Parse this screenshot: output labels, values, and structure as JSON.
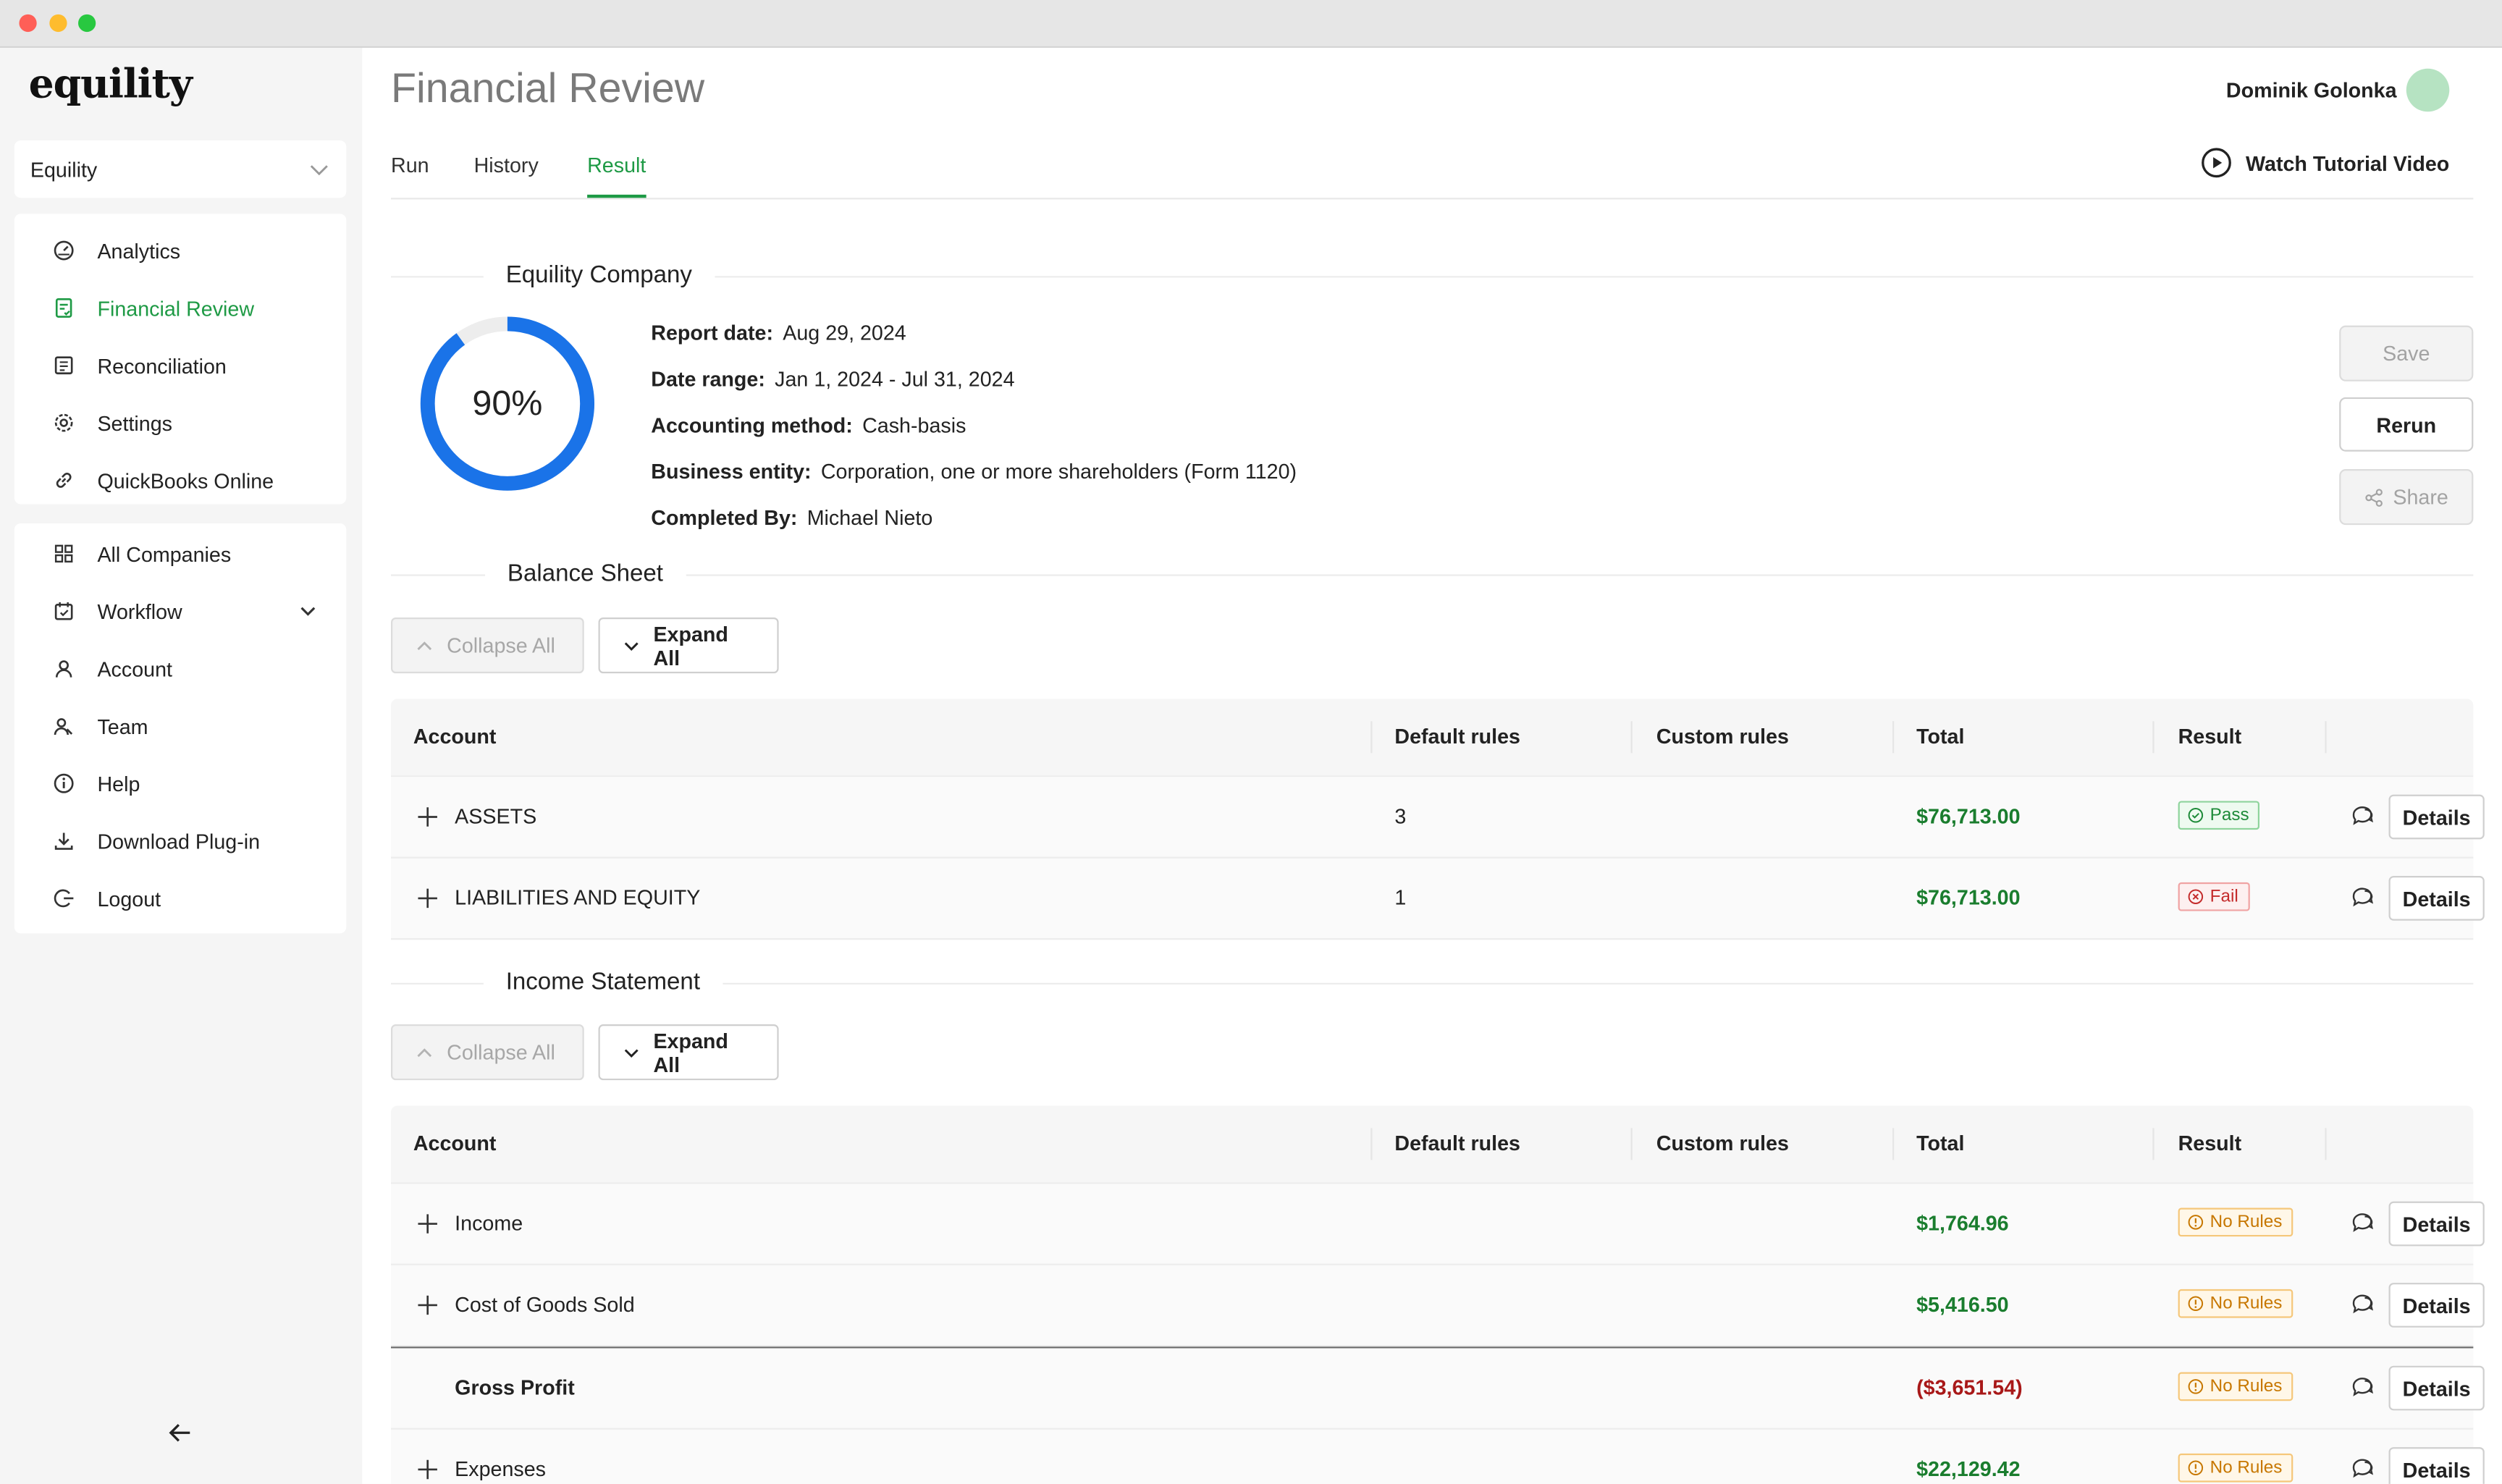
{
  "sidebar": {
    "logo": "equility",
    "company_select": "Equility",
    "group1": [
      {
        "label": "Analytics",
        "icon": "gauge-icon"
      },
      {
        "label": "Financial Review",
        "icon": "document-check-icon",
        "active": true
      },
      {
        "label": "Reconciliation",
        "icon": "ledger-icon"
      },
      {
        "label": "Settings",
        "icon": "gear-icon"
      },
      {
        "label": "QuickBooks Online",
        "icon": "link-icon"
      }
    ],
    "group2": [
      {
        "label": "All Companies",
        "icon": "grid-icon"
      },
      {
        "label": "Workflow",
        "icon": "calendar-check-icon",
        "expandable": true
      },
      {
        "label": "Account",
        "icon": "user-icon"
      },
      {
        "label": "Team",
        "icon": "team-icon"
      },
      {
        "label": "Help",
        "icon": "info-icon"
      },
      {
        "label": "Download Plug-in",
        "icon": "download-icon"
      },
      {
        "label": "Logout",
        "icon": "logout-icon"
      }
    ]
  },
  "header": {
    "title": "Financial Review",
    "user_name": "Dominik Golonka",
    "tabs": [
      {
        "label": "Run"
      },
      {
        "label": "History"
      },
      {
        "label": "Result",
        "active": true
      }
    ],
    "tutorial_label": "Watch Tutorial Video"
  },
  "company": {
    "section_title": "Equility Company",
    "progress_label": "90%",
    "progress": 0.9,
    "info": [
      {
        "key": "Report date:",
        "value": "Aug 29, 2024"
      },
      {
        "key": "Date range:",
        "value": "Jan 1, 2024 - Jul 31, 2024"
      },
      {
        "key": "Accounting method:",
        "value": "Cash-basis"
      },
      {
        "key": "Business entity:",
        "value": "Corporation, one or more shareholders (Form 1120)"
      },
      {
        "key": "Completed By:",
        "value": "Michael Nieto"
      }
    ],
    "actions": {
      "save": "Save",
      "rerun": "Rerun",
      "share": "Share"
    }
  },
  "controls": {
    "collapse_all": "Collapse All",
    "expand_all": "Expand All"
  },
  "table_headers": {
    "account": "Account",
    "default_rules": "Default rules",
    "custom_rules": "Custom rules",
    "total": "Total",
    "result": "Result"
  },
  "details_label": "Details",
  "balance_sheet": {
    "title": "Balance Sheet",
    "rows": [
      {
        "account": "ASSETS",
        "default_rules": "3",
        "custom_rules": "",
        "total": "$76,713.00",
        "result": "Pass"
      },
      {
        "account": "LIABILITIES AND EQUITY",
        "default_rules": "1",
        "custom_rules": "",
        "total": "$76,713.00",
        "result": "Fail"
      }
    ]
  },
  "income_statement": {
    "title": "Income Statement",
    "rows": [
      {
        "account": "Income",
        "default_rules": "",
        "custom_rules": "",
        "total": "$1,764.96",
        "result": "No Rules"
      },
      {
        "account": "Cost of Goods Sold",
        "default_rules": "",
        "custom_rules": "",
        "total": "$5,416.50",
        "result": "No Rules"
      },
      {
        "account": "Gross Profit",
        "default_rules": "",
        "custom_rules": "",
        "total": "($3,651.54)",
        "result": "No Rules"
      },
      {
        "account": "Expenses",
        "default_rules": "",
        "custom_rules": "",
        "total": "$22,129.42",
        "result": "No Rules"
      }
    ]
  },
  "colors": {
    "accent": "#1e9a45",
    "progress_ring": "#1a73e8",
    "positive_total": "#1a7d2e",
    "negative_total": "#a81818"
  }
}
